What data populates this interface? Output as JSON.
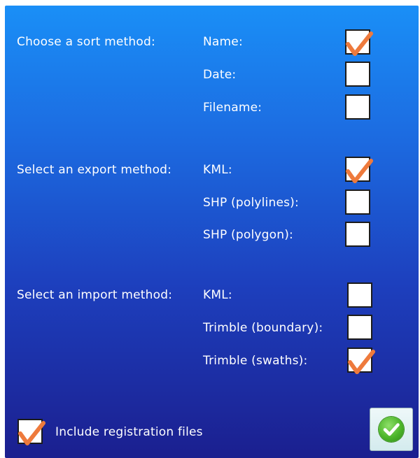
{
  "sort": {
    "heading": "Choose a sort method:",
    "options": [
      {
        "label": "Name:",
        "checked": true
      },
      {
        "label": "Date:",
        "checked": false
      },
      {
        "label": "Filename:",
        "checked": false
      }
    ]
  },
  "export": {
    "heading": "Select an export method:",
    "options": [
      {
        "label": "KML:",
        "checked": true
      },
      {
        "label": "SHP (polylines):",
        "checked": false
      },
      {
        "label": "SHP (polygon):",
        "checked": false
      }
    ]
  },
  "import": {
    "heading": "Select an import method:",
    "options": [
      {
        "label": "KML:",
        "checked": false
      },
      {
        "label": "Trimble (boundary):",
        "checked": false
      },
      {
        "label": "Trimble (swaths):",
        "checked": true
      }
    ]
  },
  "registration": {
    "label": "Include registration files",
    "checked": true
  },
  "ok_button": {
    "icon": "green-check-circle-icon"
  },
  "colors": {
    "check_mark": "#ee7a3c",
    "panel_top": "#1a8ff7",
    "panel_bottom": "#1b1f8f",
    "ok_green": "#4cb52a"
  }
}
